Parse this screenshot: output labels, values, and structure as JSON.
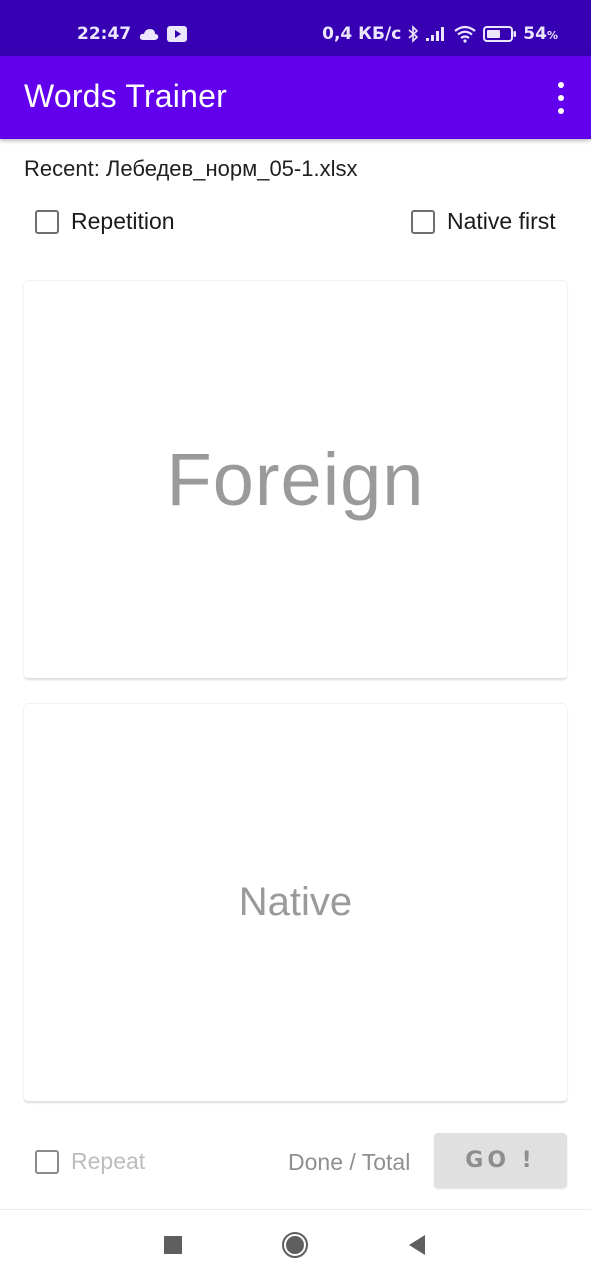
{
  "status_bar": {
    "time": "22:47",
    "network_speed": "0,4 КБ/с",
    "battery_percent": "54",
    "battery_unit": "%",
    "icons": [
      "cloud-icon",
      "youtube-icon",
      "bluetooth-icon",
      "signal-icon",
      "wifi-icon",
      "battery-icon"
    ]
  },
  "app_bar": {
    "title": "Words Trainer",
    "menu_icon": "overflow-menu-icon"
  },
  "recent_file": "Recent: Лебедев_норм_05-1.xlsx",
  "options": {
    "repetition": {
      "label": "Repetition",
      "checked": false
    },
    "native_first": {
      "label": "Native first",
      "checked": false
    }
  },
  "cards": {
    "foreign": "Foreign",
    "native": "Native"
  },
  "footer": {
    "repeat": {
      "label": "Repeat",
      "checked": false,
      "enabled": false
    },
    "progress": "Done / Total",
    "go_label": "GO !"
  },
  "nav_bar": {
    "buttons": [
      "recents-icon",
      "home-icon",
      "back-icon"
    ]
  }
}
